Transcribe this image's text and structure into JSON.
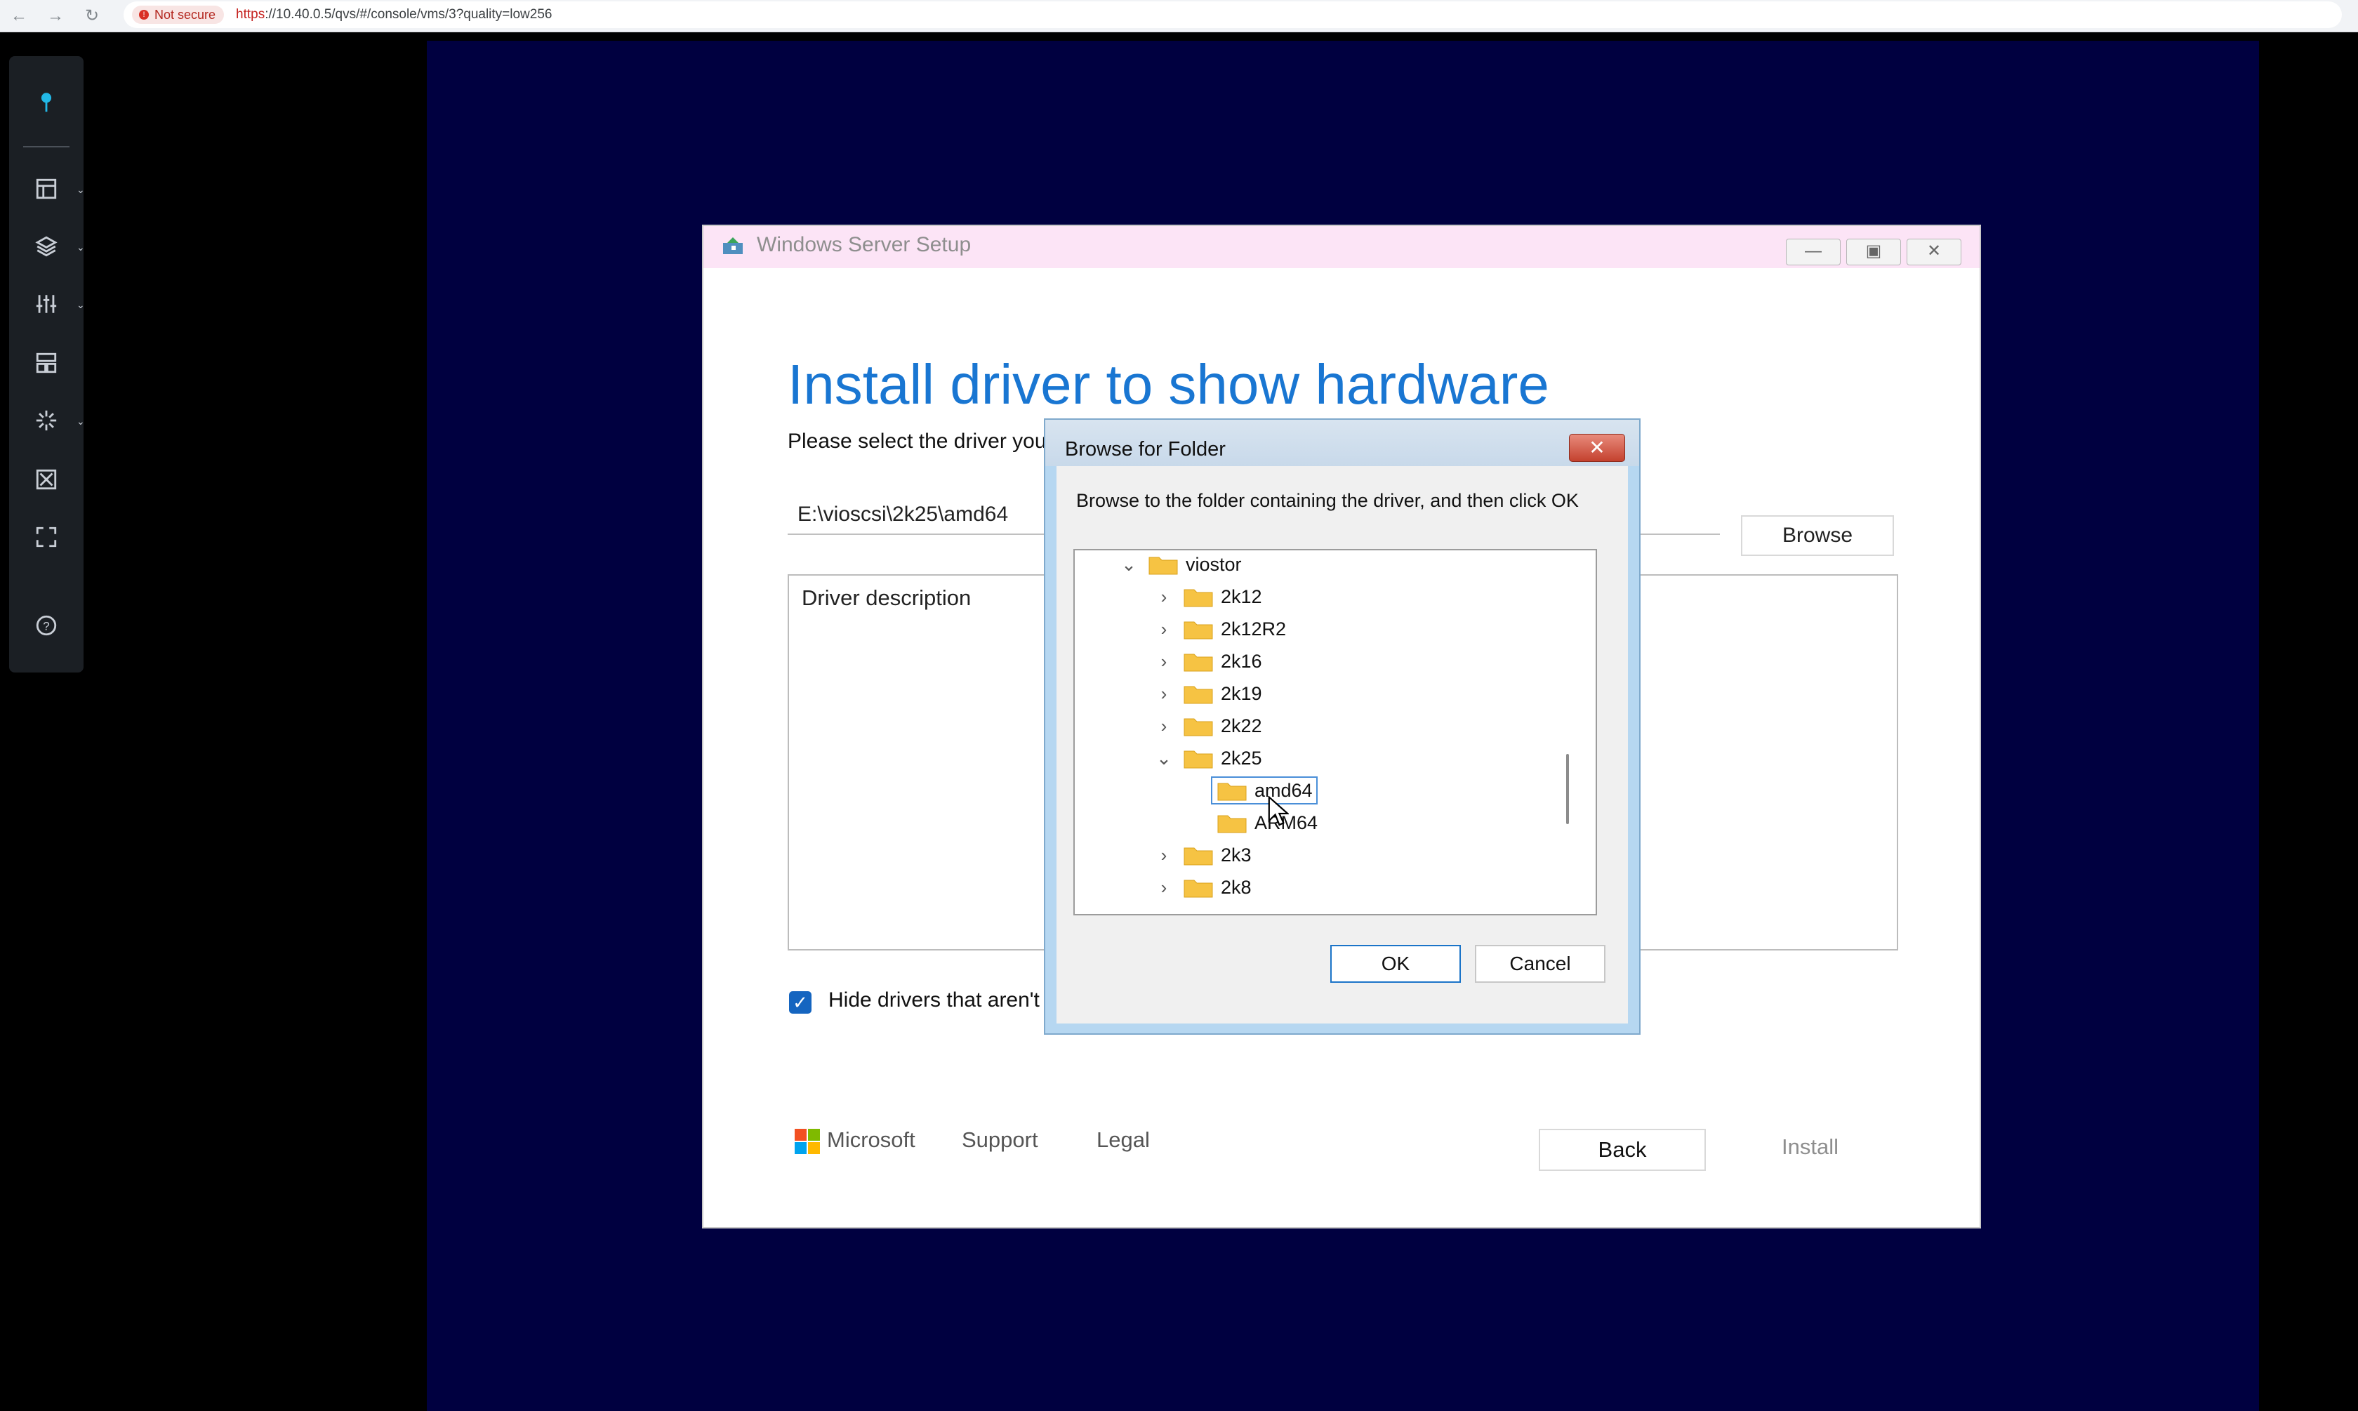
{
  "browser": {
    "security_label": "Not secure",
    "url_protocol": "https",
    "url_rest": "://10.40.0.5/qvs/#/console/vms/3?quality=low256"
  },
  "toolbar": {
    "items": [
      "pin-icon",
      "layout-icon",
      "layers-icon",
      "sliders-icon",
      "dashboard-icon",
      "sparkle-icon",
      "resize-icon",
      "fullscreen-icon",
      "help-icon"
    ]
  },
  "setup": {
    "window_title": "Windows Server Setup",
    "heading": "Install driver to show hardware",
    "instruction": "Please select the driver you",
    "path_value": "E:\\vioscsi\\2k25\\amd64",
    "browse_label": "Browse",
    "driver_description_header": "Driver description",
    "hide_drivers_label": "Hide drivers that aren't",
    "hide_drivers_checked": true,
    "footer": {
      "brand": "Microsoft",
      "support": "Support",
      "legal": "Legal"
    },
    "back_label": "Back",
    "install_label": "Install"
  },
  "dialog": {
    "title": "Browse for Folder",
    "instruction": "Browse to the folder containing the driver, and then click OK",
    "tree": [
      {
        "label": "viostor",
        "expanded": true,
        "level": 0
      },
      {
        "label": "2k12",
        "expanded": false,
        "level": 1
      },
      {
        "label": "2k12R2",
        "expanded": false,
        "level": 1
      },
      {
        "label": "2k16",
        "expanded": false,
        "level": 1
      },
      {
        "label": "2k19",
        "expanded": false,
        "level": 1
      },
      {
        "label": "2k22",
        "expanded": false,
        "level": 1
      },
      {
        "label": "2k25",
        "expanded": true,
        "level": 1
      },
      {
        "label": "amd64",
        "selected": true,
        "level": 2
      },
      {
        "label": "ARM64",
        "level": 2
      },
      {
        "label": "2k3",
        "expanded": false,
        "level": 1
      },
      {
        "label": "2k8",
        "expanded": false,
        "level": 1
      }
    ],
    "ok_label": "OK",
    "cancel_label": "Cancel"
  },
  "colors": {
    "vm_background": "#000040",
    "heading_blue": "#1976d2",
    "folder_yellow": "#f6c343",
    "dialog_frame": "#b6d7f1"
  }
}
